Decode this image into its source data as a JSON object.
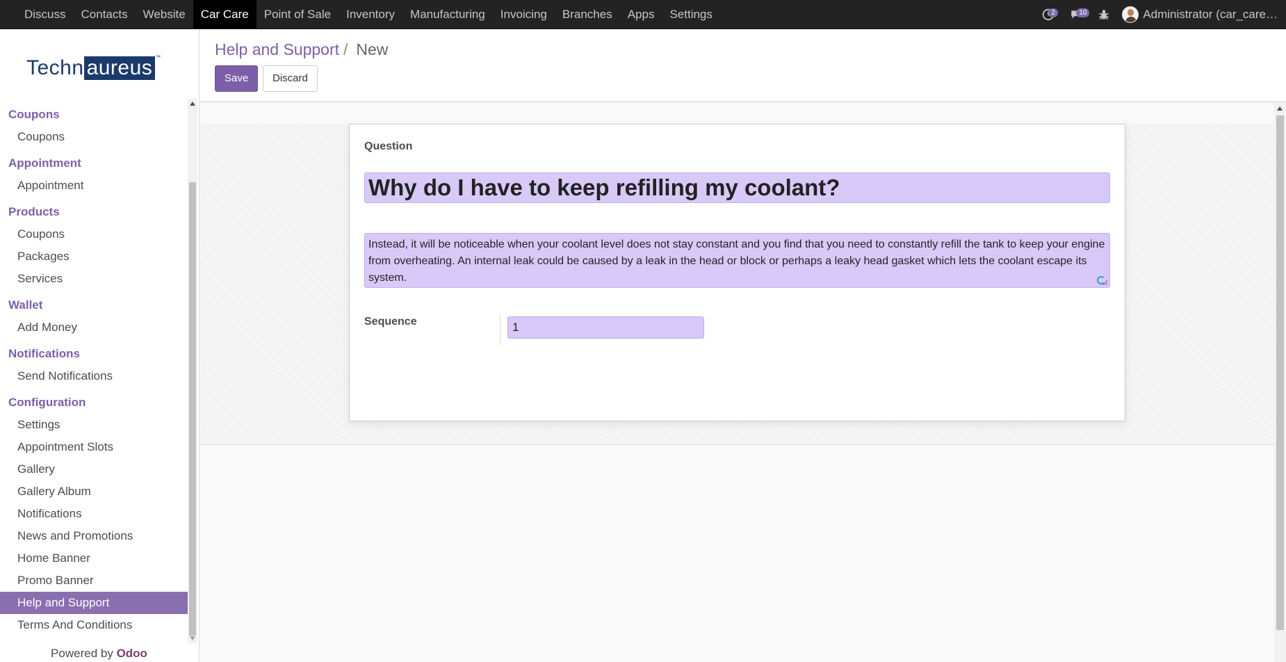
{
  "topnav": {
    "menu": [
      {
        "label": "Discuss"
      },
      {
        "label": "Contacts"
      },
      {
        "label": "Website"
      },
      {
        "label": "Car Care",
        "active": true
      },
      {
        "label": "Point of Sale"
      },
      {
        "label": "Inventory"
      },
      {
        "label": "Manufacturing"
      },
      {
        "label": "Invoicing"
      },
      {
        "label": "Branches"
      },
      {
        "label": "Apps"
      },
      {
        "label": "Settings"
      }
    ],
    "activities_count": "2",
    "messages_count": "10",
    "user_name": "Administrator (car_care…"
  },
  "sidebar": {
    "logo": {
      "part1": "Techn",
      "part2": "aureus",
      "tm": "™"
    },
    "sections": [
      {
        "title": "Coupons",
        "items": [
          "Coupons"
        ]
      },
      {
        "title": "Appointment",
        "items": [
          "Appointment"
        ]
      },
      {
        "title": "Products",
        "items": [
          "Coupons",
          "Packages",
          "Services"
        ]
      },
      {
        "title": "Wallet",
        "items": [
          "Add Money"
        ]
      },
      {
        "title": "Notifications",
        "items": [
          "Send Notifications"
        ]
      },
      {
        "title": "Configuration",
        "items": [
          "Settings",
          "Appointment Slots",
          "Gallery",
          "Gallery Album",
          "Notifications",
          "News and Promotions",
          "Home Banner",
          "Promo Banner",
          "Help and Support",
          "Terms And Conditions"
        ]
      }
    ],
    "active_item": "Help and Support",
    "powered_by": "Powered by",
    "powered_brand": "Odoo"
  },
  "control": {
    "breadcrumb_parent": "Help and Support",
    "breadcrumb_sep": "/",
    "breadcrumb_current": "New",
    "save_label": "Save",
    "discard_label": "Discard"
  },
  "form": {
    "question_label": "Question",
    "question_value": "Why do I have to keep refilling my coolant?",
    "answer_value": "Instead, it will be noticeable when your coolant level does not stay constant and you find that you need to constantly refill the tank to keep your engine from overheating. An internal leak could be caused by a leak in the head or block or perhaps a leaky head gasket which lets the coolant escape its system.",
    "sequence_label": "Sequence",
    "sequence_value": "1"
  },
  "colors": {
    "accent": "#7c5fa8",
    "field_bg": "#d8c9f9",
    "navbar_bg": "#232323"
  }
}
